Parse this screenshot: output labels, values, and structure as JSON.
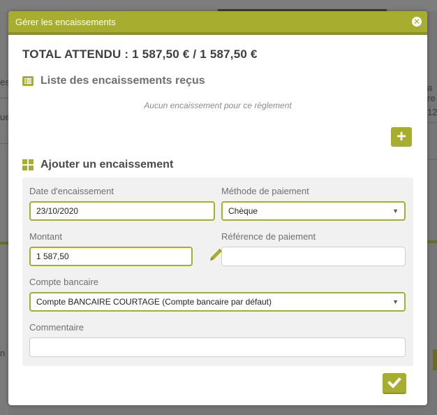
{
  "background": {
    "left_texts": [
      "es",
      "ue",
      "n"
    ],
    "right_texts": [
      "a re",
      "12"
    ]
  },
  "modal": {
    "title": "Gérer les encaissements",
    "close_icon": "close-circle-icon",
    "total": "TOTAL ATTENDU : 1 587,50 € / 1 587,50 €",
    "received_section": {
      "title": "Liste des encaissements reçus",
      "icon": "list-icon",
      "empty_message": "Aucun encaissement pour ce règlement"
    },
    "add_button_icon": "plus-icon",
    "add_section": {
      "title": "Ajouter un encaissement",
      "icon": "grid-icon"
    },
    "form": {
      "date": {
        "label": "Date d'encaissement",
        "value": "23/10/2020"
      },
      "method": {
        "label": "Méthode de paiement",
        "value": "Chèque"
      },
      "amount": {
        "label": "Montant",
        "value": "1 587,50"
      },
      "reference": {
        "label": "Référence de paiement",
        "value": ""
      },
      "account": {
        "label": "Compte bancaire",
        "value": "Compte BANCAIRE COURTAGE (Compte bancaire par défaut)"
      },
      "comment": {
        "label": "Commentaire",
        "value": ""
      }
    },
    "submit_icon": "check-icon",
    "colors": {
      "accent": "#a7ad2f",
      "accent_dark": "#8c9124"
    }
  }
}
